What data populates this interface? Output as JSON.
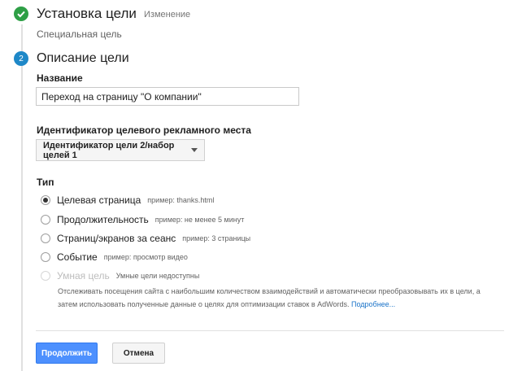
{
  "step1": {
    "title": "Установка цели",
    "action_label": "Изменение",
    "subtitle": "Специальная цель"
  },
  "step2": {
    "number": "2",
    "title": "Описание цели",
    "name_label": "Название",
    "name_value": "Переход на страницу \"О компании\"",
    "slot_label": "Идентификатор целевого рекламного места",
    "slot_value": "Идентификатор цели 2/набор целей 1",
    "type_label": "Тип",
    "options": [
      {
        "label": "Целевая страница",
        "hint": "пример: thanks.html",
        "checked": true
      },
      {
        "label": "Продолжительность",
        "hint": "пример: не менее 5 минут",
        "checked": false
      },
      {
        "label": "Страниц/экранов за сеанс",
        "hint": "пример: 3 страницы",
        "checked": false
      },
      {
        "label": "Событие",
        "hint": "пример: просмотр видео",
        "checked": false
      },
      {
        "label": "Умная цель",
        "hint": "Умные цели недоступны",
        "checked": false,
        "disabled": true
      }
    ],
    "smart_desc": "Отслеживать посещения сайта с наибольшим количеством взаимодействий и автоматически преобразовывать их в цели, а затем использовать полученные данные о целях для оптимизации ставок в AdWords.",
    "smart_link": "Подробнее..."
  },
  "buttons": {
    "continue": "Продолжить",
    "cancel": "Отмена"
  },
  "colors": {
    "check_green": "#2e9f46",
    "step_blue": "#1e88c8",
    "primary_button": "#4d90fe",
    "link": "#1a73c8"
  }
}
